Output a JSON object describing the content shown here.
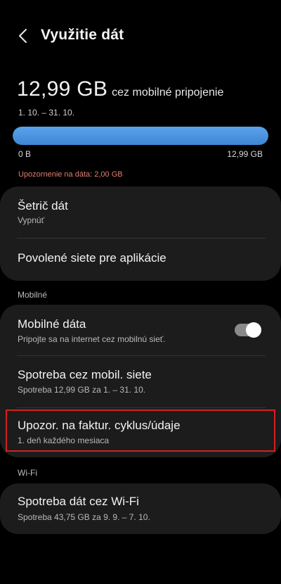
{
  "header": {
    "title": "Využitie dát",
    "back_icon": "chevron-left-icon"
  },
  "usage": {
    "amount": "12,99 GB",
    "suffix": "cez mobilné pripojenie",
    "period": "1. 10. – 31. 10.",
    "bar_fill_fraction": 1.0,
    "bar_min_label": "0 B",
    "bar_max_label": "12,99 GB",
    "warning": "Upozornenie na dáta: 2,00 GB",
    "bar_color": "#4a90e2",
    "warning_color": "#e07f6e"
  },
  "card1": {
    "saver_title": "Šetrič dát",
    "saver_sub": "Vypnúť",
    "allowed_title": "Povolené siete pre aplikácie"
  },
  "mobile_section": {
    "label": "Mobilné",
    "mobile_data_title": "Mobilné dáta",
    "mobile_data_sub": "Pripojte sa na internet cez mobilnú sieť.",
    "mobile_data_enabled": true,
    "usage_title": "Spotreba cez mobil. siete",
    "usage_sub": "Spotreba 12,99 GB za 1. – 31. 10.",
    "billing_title": "Upozor. na faktur. cyklus/údaje",
    "billing_sub": "1. deň každého mesiaca"
  },
  "wifi_section": {
    "label": "Wi-Fi",
    "usage_title": "Spotreba dát cez Wi-Fi",
    "usage_sub": "Spotreba 43,75 GB za 9. 9. – 7. 10."
  }
}
